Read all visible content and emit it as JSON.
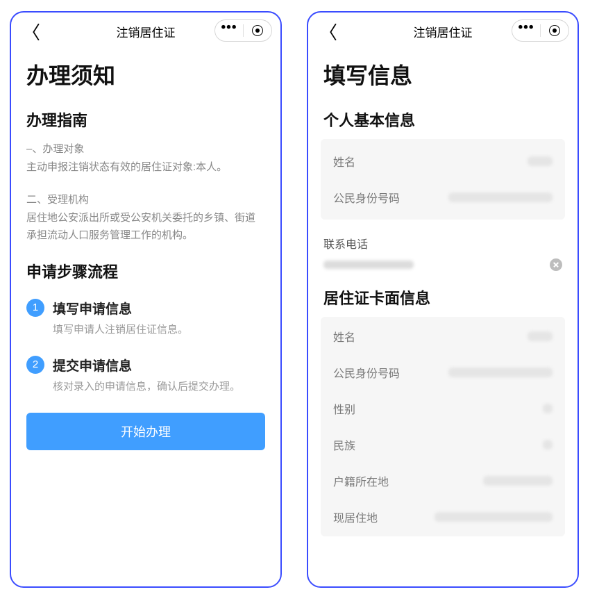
{
  "left": {
    "header": {
      "title": "注销居住证"
    },
    "page_title": "办理须知",
    "guide_title": "办理指南",
    "guide_para1_line1": "–、办理对象",
    "guide_para1_line2": "主动申报注销状态有效的居住证对象:本人。",
    "guide_para2_line1": "二、受理机构",
    "guide_para2_line2": "居住地公安派出所或受公安机关委托的乡镇、街道承担流动人口服务管理工作的机构。",
    "steps_title": "申请步骤流程",
    "steps": [
      {
        "num": "1",
        "label": "填写申请信息",
        "desc": "填写申请人注销居住证信息。"
      },
      {
        "num": "2",
        "label": "提交申请信息",
        "desc": "核对录入的申请信息，确认后提交办理。"
      }
    ],
    "primary_button": "开始办理"
  },
  "right": {
    "header": {
      "title": "注销居住证"
    },
    "page_title": "填写信息",
    "section_personal": "个人基本信息",
    "personal_rows": {
      "name_label": "姓名",
      "id_label": "公民身份号码"
    },
    "contact": {
      "label": "联系电话"
    },
    "section_card": "居住证卡面信息",
    "card_rows": {
      "name_label": "姓名",
      "id_label": "公民身份号码",
      "gender_label": "性别",
      "ethnicity_label": "民族",
      "domicile_label": "户籍所在地",
      "residence_label": "现居住地"
    }
  }
}
